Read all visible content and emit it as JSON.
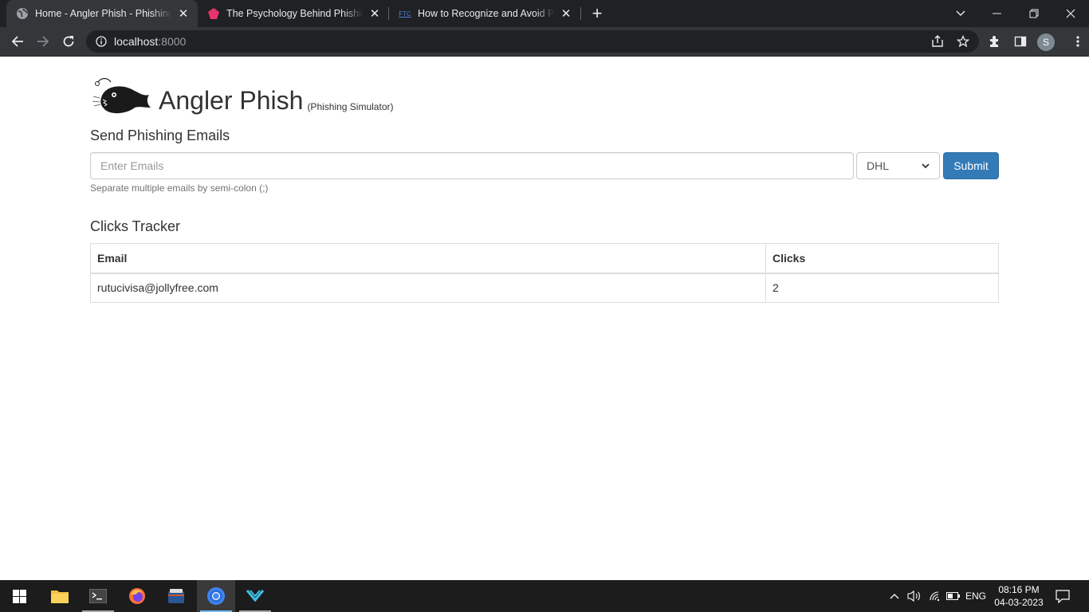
{
  "browser": {
    "tabs": [
      {
        "title": "Home - Angler Phish - Phishing Simulator",
        "favicon": "globe-icon",
        "active": true
      },
      {
        "title": "The Psychology Behind Phishing Attacks",
        "favicon": "pink-gem-icon",
        "active": false
      },
      {
        "title": "How to Recognize and Avoid Phishing Scams",
        "favicon": "ftc-icon",
        "favicon_text": "FTC",
        "active": false
      }
    ],
    "address": {
      "host": "localhost",
      "port": ":8000"
    },
    "profile_initial": "S"
  },
  "app": {
    "name": "Angler Phish",
    "subtitle": "(Phishing Simulator)",
    "send_section": {
      "heading": "Send Phishing Emails",
      "email_placeholder": "Enter Emails",
      "email_value": "",
      "template_selected": "DHL",
      "submit_label": "Submit",
      "help_text": "Separate multiple emails by semi-colon (;)"
    },
    "tracker": {
      "heading": "Clicks Tracker",
      "columns": [
        "Email",
        "Clicks"
      ],
      "rows": [
        {
          "email": "rutucivisa@jollyfree.com",
          "clicks": "2"
        }
      ]
    }
  },
  "taskbar": {
    "language": "ENG",
    "time": "08:16 PM",
    "date": "04-03-2023"
  },
  "colors": {
    "primary_button": "#337ab7",
    "chrome_dark": "#202124",
    "chrome_toolbar": "#35363a",
    "taskbar": "#1c1c1c"
  }
}
